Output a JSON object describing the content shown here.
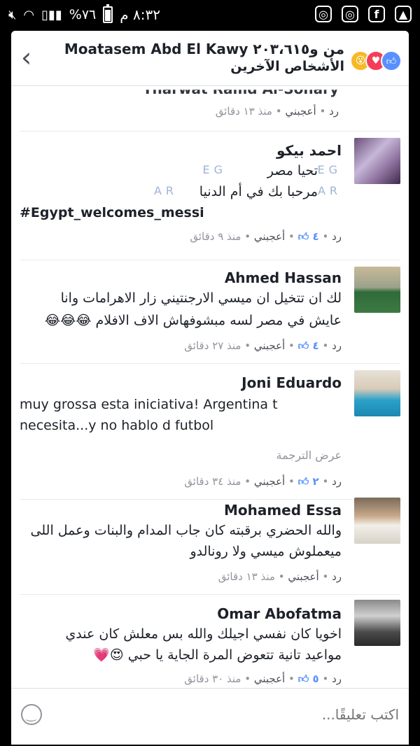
{
  "status_bar": {
    "time": "٨:٣٢ م",
    "battery": "٧٦%",
    "apps": [
      "instagram-icon",
      "instagram-icon",
      "facebook-icon",
      "gallery-icon"
    ]
  },
  "header": {
    "title": "Moatasem Abd El Kawy من و٢٠٣،٦١٥",
    "subtitle": "الأشخاص الآخرين",
    "reactions": [
      "like",
      "love",
      "wow"
    ]
  },
  "colors": {
    "link": "#4267b2",
    "meta": "#90949c",
    "like": "#5890ff"
  },
  "partial_comment": {
    "name_fragment": "Tharwat Ramd Al-Sohary",
    "time": "منذ ١٣ دقائق",
    "like": "أعجبني",
    "reply": "رد"
  },
  "comments": [
    {
      "name": "احمد بيكو",
      "lines": [
        "تحيا مصر",
        "مرحبا بك في أم الدنيا",
        "#Egypt_welcomes_messi"
      ],
      "time": "منذ ٩ دقائق",
      "like": "أعجبني",
      "likes": "٤",
      "reply": "رد"
    },
    {
      "name": "Ahmed Hassan",
      "lines": [
        "لك ان تتخيل ان ميسي الارجنتيني زار الاهرامات وانا",
        "عايش في مصر لسه مبشوفهاش الاف الافلام 😂😂😂"
      ],
      "time": "منذ ٢٧ دقائق",
      "like": "أعجبني",
      "likes": "٤",
      "reply": "رد"
    },
    {
      "name": "Joni Eduardo",
      "lines": [
        "muy grossa esta iniciativa! Argentina t",
        "necesita...y no hablo d futbol"
      ],
      "see_translation": "عرض الترجمة",
      "time": "منذ ٣٤ دقائق",
      "like": "أعجبني",
      "likes": "٢",
      "reply": "رد"
    },
    {
      "name": "Mohamed Essa",
      "lines": [
        "والله الحضري برقبته كان جاب المدام والبنات وعمل اللى",
        "ميعملوش ميسي ولا رونالدو"
      ],
      "time": "منذ ١٣ دقائق",
      "like": "أعجبني",
      "reply": "رد"
    },
    {
      "name": "Omar Abofatma",
      "lines": [
        "اخويا كان نفسي اجيلك والله بس معلش كان عندي",
        "مواعيد تانية تتعوض المرة الجاية يا حبي 😍💗"
      ],
      "time": "منذ ٣٠ دقائق",
      "like": "أعجبني",
      "likes": "٥",
      "reply": "رد"
    }
  ],
  "footer": {
    "placeholder": "اكتب تعليقًا..."
  }
}
